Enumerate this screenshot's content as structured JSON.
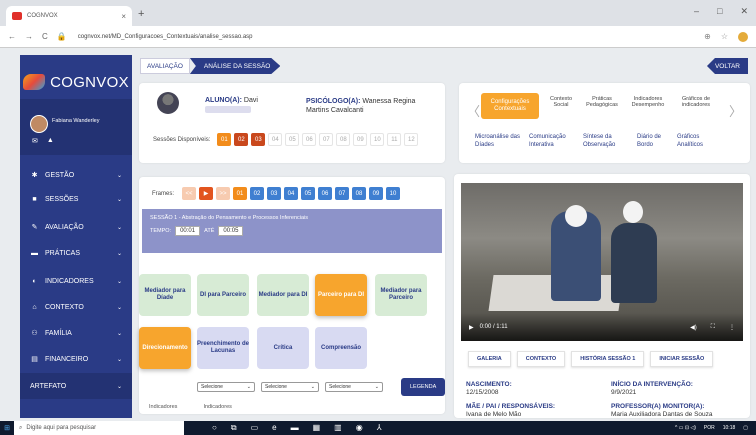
{
  "browser": {
    "tab_title": "COGNVOX",
    "url": "cognvox.net/MD_Configuracoes_Contextuais/analise_sessao.asp",
    "new_tab": "+",
    "close": "×",
    "back": "←",
    "forward": "→",
    "reload": "C",
    "min": "–",
    "max": "□",
    "close_win": "✕"
  },
  "sidebar": {
    "logo": "COGNVOX",
    "user": "Fabiana Wanderley",
    "items": [
      {
        "label": "GESTÃO",
        "icon": "gear-icon"
      },
      {
        "label": "SESSÕES",
        "icon": "video-icon"
      },
      {
        "label": "AVALIAÇÃO",
        "icon": "edit-icon"
      },
      {
        "label": "PRÁTICAS",
        "icon": "board-icon"
      },
      {
        "label": "INDICADORES",
        "icon": "chart-icon"
      },
      {
        "label": "CONTEXTO",
        "icon": "home-icon"
      },
      {
        "label": "FAMÍLIA",
        "icon": "family-icon"
      },
      {
        "label": "FINANCEIRO",
        "icon": "money-icon"
      },
      {
        "label": "ARTEFATO",
        "icon": ""
      }
    ]
  },
  "breadcrumb": {
    "step1": "AVALIAÇÃO",
    "step2": "ANÁLISE DA SESSÃO"
  },
  "voltar": "VOLTAR",
  "student": {
    "aluno_label": "ALUNO(A):",
    "aluno_value": "Davi",
    "psico_label": "PSICÓLOGO(A):",
    "psico_value": "Wanessa Regina Martins Cavalcanti",
    "sessoes_label": "Sessões Disponíveis:",
    "sessions": [
      "01",
      "02",
      "03",
      "04",
      "05",
      "06",
      "07",
      "08",
      "09",
      "10",
      "11",
      "12"
    ]
  },
  "tabs": {
    "row1": [
      "Configurações Contextuais",
      "Contexto Social",
      "Práticas Pedagógicas",
      "Indicadores Desempenho",
      "Gráficos de indicadores"
    ],
    "row2": [
      "Microanálise das Díades",
      "Comunicação Interativa",
      "Síntese da Observação",
      "Diário de Bordo",
      "Gráficos Analíticos"
    ]
  },
  "frames": {
    "label": "Frames:",
    "controls": [
      "<<",
      "▶",
      ">>"
    ],
    "items": [
      "01",
      "02",
      "03",
      "04",
      "05",
      "06",
      "07",
      "08",
      "09",
      "10"
    ]
  },
  "session": {
    "title": "SESSÃO 1 - Abstração do Pensamento e Processos Inferenciais",
    "tempo_label": "TEMPO:",
    "start": "00:01",
    "ate": "ATÉ",
    "end": "00:05"
  },
  "grid": {
    "row1": [
      "Mediador para Díade",
      "DI para Parceiro",
      "Mediador para DI",
      "Parceiro para DI",
      "Mediador para Parceiro"
    ],
    "row2": [
      "Direcionamento",
      "Preenchimento de Lacunas",
      "Crítica",
      "Compreensão"
    ],
    "selects": [
      "Selecione",
      "Selecione",
      "Selecione"
    ],
    "legenda": "LEGENDA",
    "row3": [
      "Indicadores",
      "Indicadores"
    ]
  },
  "video": {
    "time": "0:00 / 1:11"
  },
  "vtabs": [
    "GALERIA",
    "CONTEXTO",
    "HISTÓRIA SESSÃO 1",
    "INICIAR SESSÃO"
  ],
  "info": {
    "nasc_label": "NASCIMENTO:",
    "nasc_value": "12/15/2008",
    "inicio_label": "INÍCIO DA INTERVENÇÃO:",
    "inicio_value": "9/9/2021",
    "mae_label": "MÃE / PAI / RESPONSÁVEIS:",
    "mae_value": "Ivana de Melo Mão",
    "prof_label": "PROFESSOR(A) MONITOR(A):",
    "prof_value": "Maria Auxiliadora Dantas de Souza"
  },
  "taskbar": {
    "search": "Digite aqui para pesquisar",
    "lang": "POR",
    "time": "10:18"
  }
}
